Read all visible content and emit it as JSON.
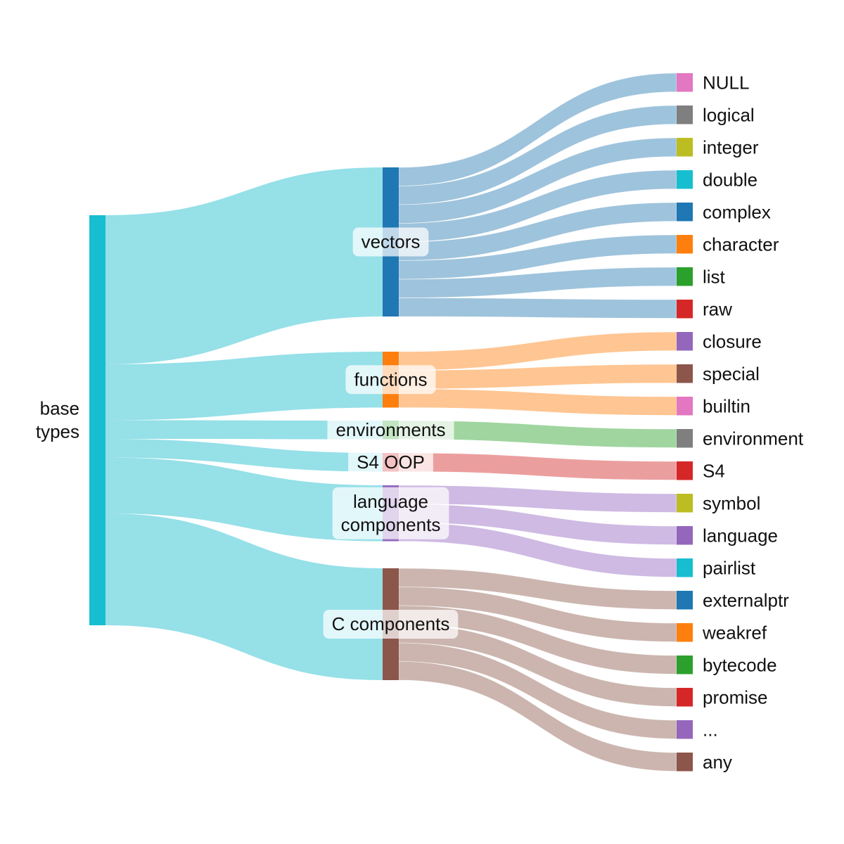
{
  "chart_data": {
    "type": "sankey",
    "title": "",
    "root": {
      "id": "base",
      "label": "base types",
      "label_lines": [
        "base",
        "types"
      ],
      "color": "#17becf"
    },
    "groups": [
      {
        "id": "vectors",
        "label": "vectors",
        "label_lines": [
          "vectors"
        ],
        "color": "#1f77b4",
        "link_color": "#9ec3dc",
        "leaves": [
          {
            "label": "NULL",
            "color": "#e377c2",
            "value": 1
          },
          {
            "label": "logical",
            "color": "#7f7f7f",
            "value": 1
          },
          {
            "label": "integer",
            "color": "#bcbd22",
            "value": 1
          },
          {
            "label": "double",
            "color": "#17becf",
            "value": 1
          },
          {
            "label": "complex",
            "color": "#1f77b4",
            "value": 1
          },
          {
            "label": "character",
            "color": "#ff7f0e",
            "value": 1
          },
          {
            "label": "list",
            "color": "#2ca02c",
            "value": 1
          },
          {
            "label": "raw",
            "color": "#d62728",
            "value": 1
          }
        ]
      },
      {
        "id": "functions",
        "label": "functions",
        "label_lines": [
          "functions"
        ],
        "color": "#ff7f0e",
        "link_color": "#ffc592",
        "leaves": [
          {
            "label": "closure",
            "color": "#9467bd",
            "value": 1
          },
          {
            "label": "special",
            "color": "#8c564b",
            "value": 1
          },
          {
            "label": "builtin",
            "color": "#e377c2",
            "value": 1
          }
        ]
      },
      {
        "id": "environments",
        "label": "environments",
        "label_lines": [
          "environments"
        ],
        "color": "#2ca02c",
        "link_color": "#a0d5a0",
        "leaves": [
          {
            "label": "environment",
            "color": "#7f7f7f",
            "value": 1
          }
        ]
      },
      {
        "id": "s4oop",
        "label": "S4 OOP",
        "label_lines": [
          "S4 OOP"
        ],
        "color": "#d62728",
        "link_color": "#eb9e9e",
        "leaves": [
          {
            "label": "S4",
            "color": "#d62728",
            "value": 1
          }
        ]
      },
      {
        "id": "language",
        "label": "language components",
        "label_lines": [
          "language",
          "components"
        ],
        "color": "#9467bd",
        "link_color": "#cfbae3",
        "leaves": [
          {
            "label": "symbol",
            "color": "#bcbd22",
            "value": 1
          },
          {
            "label": "language",
            "color": "#9467bd",
            "value": 1
          },
          {
            "label": "pairlist",
            "color": "#17becf",
            "value": 1
          }
        ]
      },
      {
        "id": "ccomp",
        "label": "C components",
        "label_lines": [
          "C components"
        ],
        "color": "#8c564b",
        "link_color": "#cbb5ae",
        "leaves": [
          {
            "label": "externalptr",
            "color": "#1f77b4",
            "value": 1
          },
          {
            "label": "weakref",
            "color": "#ff7f0e",
            "value": 1
          },
          {
            "label": "bytecode",
            "color": "#2ca02c",
            "value": 1
          },
          {
            "label": "promise",
            "color": "#d62728",
            "value": 1
          },
          {
            "label": "...",
            "color": "#9467bd",
            "value": 1
          },
          {
            "label": "any",
            "color": "#8c564b",
            "value": 1
          }
        ]
      }
    ],
    "root_link_color": "#96e0e8"
  }
}
